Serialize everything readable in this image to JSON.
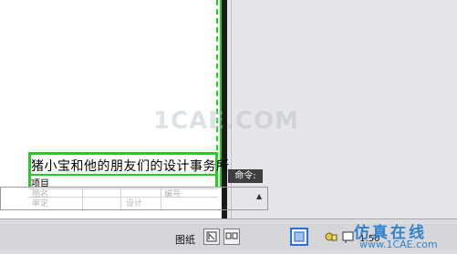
{
  "title_block": {
    "company_name": "猪小宝和他的朋友们的设计事务所",
    "project_label": "项目",
    "drawing_name_label": "图名",
    "number_label": "编号",
    "review_label": "审定",
    "design_label": "设计"
  },
  "command": {
    "label": "命令:",
    "input_value": ""
  },
  "watermark": "1CAE.COM",
  "statusbar": {
    "paper_label": "图纸",
    "model_icon": "model-icon",
    "layout_icon": "layout-icon",
    "viewport_icon": "viewport-icon",
    "annotation_icon": "annotation-icon",
    "scale_label": "1:50"
  },
  "brand": {
    "name": "仿真在线",
    "url": "www.1CAE.com"
  },
  "colors": {
    "border_green": "#22cc22",
    "brand_blue": "#2e83d1",
    "divider": "#1a1a1a"
  }
}
